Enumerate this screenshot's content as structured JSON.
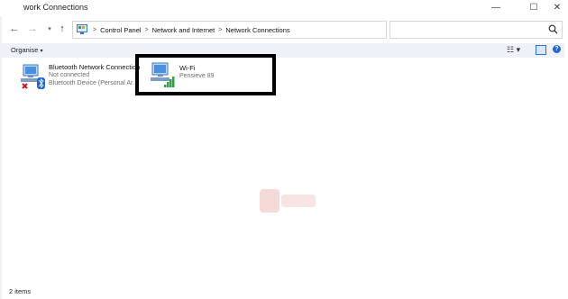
{
  "window": {
    "title": "work Connections",
    "minimize_glyph": "—",
    "maximize_glyph": "☐",
    "close_glyph": "✕"
  },
  "navigation": {
    "back_glyph": "←",
    "forward_glyph": "→",
    "recent_glyph": "▾",
    "up_glyph": "↑"
  },
  "address_bar": {
    "crumbs": [
      "Control Panel",
      "Network and Internet",
      "Network Connections"
    ],
    "separator": ">",
    "dropdown_glyph": "▾",
    "refresh_glyph": "↻"
  },
  "search": {
    "placeholder": ""
  },
  "command_bar": {
    "organise_label": "Organise",
    "organise_caret": "▾",
    "view_glyph": "☷ ▾",
    "help_glyph": "?"
  },
  "connections": [
    {
      "name": "Bluetooth Network Connection",
      "status": "Not connected",
      "device": "Bluetooth Device (Personal Ar...",
      "icon": "network-computer-icon",
      "overlay_icon": "bluetooth-icon",
      "status_icon": "red-x-icon"
    },
    {
      "name": "Wi-Fi",
      "status": "Pensieve 89",
      "icon": "network-computer-icon",
      "overlay_icon": "wifi-signal-bars-icon"
    }
  ],
  "status_bar": {
    "item_count": "2 items"
  },
  "colors": {
    "accent": "#1e66d0",
    "command_bar_bg": "#eef2f8",
    "highlight_border": "#000000",
    "error_red": "#d11a1a",
    "signal_green": "#2ea043"
  }
}
